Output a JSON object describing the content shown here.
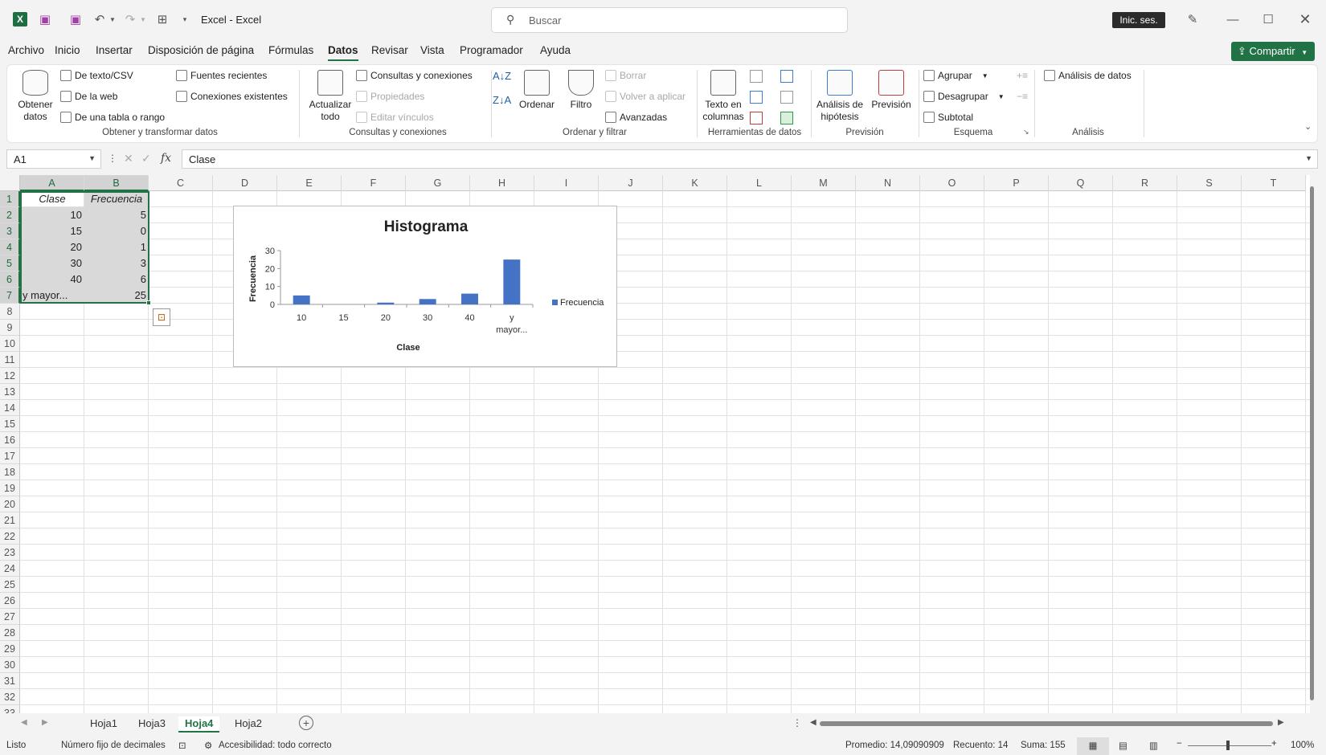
{
  "titlebar": {
    "title": "Excel  -  Excel",
    "search_placeholder": "Buscar",
    "signin_label": "Inic. ses."
  },
  "menu": [
    "Archivo",
    "Inicio",
    "Insertar",
    "Disposición de página",
    "Fórmulas",
    "Datos",
    "Revisar",
    "Vista",
    "Programador",
    "Ayuda"
  ],
  "share_label": "Compartir",
  "ribbon": {
    "get_data": "Obtener datos",
    "from_text": "De texto/CSV",
    "from_web": "De la web",
    "from_table": "De una tabla o rango",
    "recent_sources": "Fuentes recientes",
    "existing_connections": "Conexiones existentes",
    "group1": "Obtener y transformar datos",
    "refresh_all": "Actualizar todo",
    "queries_connections": "Consultas y conexiones",
    "properties": "Propiedades",
    "edit_links": "Editar vínculos",
    "group2": "Consultas y conexiones",
    "sort": "Ordenar",
    "filter": "Filtro",
    "clear": "Borrar",
    "reapply": "Volver a aplicar",
    "advanced": "Avanzadas",
    "group3": "Ordenar y filtrar",
    "text_to_columns": "Texto en columnas",
    "group4": "Herramientas de datos",
    "whatif": "Análisis de hipótesis",
    "forecast": "Previsión",
    "group5": "Previsión",
    "group_btn": "Agrupar",
    "ungroup_btn": "Desagrupar",
    "subtotal": "Subtotal",
    "group6": "Esquema",
    "data_analysis": "Análisis de datos",
    "group7": "Análisis"
  },
  "formula": {
    "namebox": "A1",
    "content": "Clase"
  },
  "columns": [
    "A",
    "B",
    "C",
    "D",
    "E",
    "F",
    "G",
    "H",
    "I",
    "J",
    "K",
    "L",
    "M",
    "N",
    "O",
    "P",
    "Q",
    "R",
    "S",
    "T"
  ],
  "rows": [
    "1",
    "2",
    "3",
    "4",
    "5",
    "6",
    "7",
    "8",
    "9",
    "10",
    "11",
    "12",
    "13",
    "14",
    "15",
    "16",
    "17",
    "18",
    "19",
    "20",
    "21",
    "22",
    "23",
    "24",
    "25",
    "26",
    "27",
    "28",
    "29",
    "30",
    "31",
    "32",
    "33"
  ],
  "table": {
    "header": [
      "Clase",
      "Frecuencia"
    ],
    "rows": [
      [
        "10",
        "5"
      ],
      [
        "15",
        "0"
      ],
      [
        "20",
        "1"
      ],
      [
        "30",
        "3"
      ],
      [
        "40",
        "6"
      ],
      [
        "y mayor...",
        "25"
      ]
    ]
  },
  "chart_data": {
    "type": "bar",
    "title": "Histograma",
    "xlabel": "Clase",
    "ylabel": "Frecuencia",
    "categories": [
      "10",
      "15",
      "20",
      "30",
      "40",
      "y mayor..."
    ],
    "series": [
      {
        "name": "Frecuencia",
        "values": [
          5,
          0,
          1,
          3,
          6,
          25
        ]
      }
    ],
    "ylim": [
      0,
      30
    ],
    "yticks": [
      0,
      10,
      20,
      30
    ],
    "legend": "right",
    "color": "#4472c4"
  },
  "sheets": [
    "Hoja1",
    "Hoja3",
    "Hoja4",
    "Hoja2"
  ],
  "active_sheet": "Hoja4",
  "status": {
    "ready": "Listo",
    "fixed_decimal": "Número fijo de decimales",
    "accessibility": "Accesibilidad: todo correcto",
    "average": "Promedio: 14,09090909",
    "count": "Recuento: 14",
    "sum": "Suma: 155",
    "zoom": "100%"
  },
  "colors": {
    "accent": "#217346",
    "bar": "#4472c4"
  }
}
